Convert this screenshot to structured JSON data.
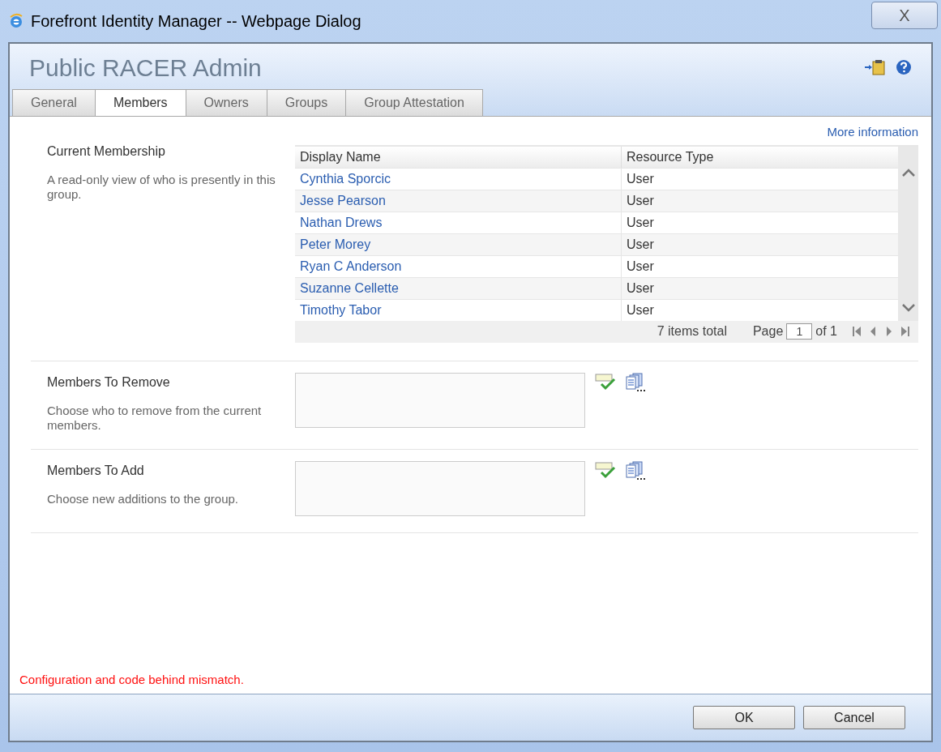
{
  "window": {
    "title": "Forefront Identity Manager -- Webpage Dialog",
    "close": "X"
  },
  "header": {
    "title": "Public RACER Admin"
  },
  "tabs": [
    {
      "label": "General",
      "selected": false
    },
    {
      "label": "Members",
      "selected": true
    },
    {
      "label": "Owners",
      "selected": false
    },
    {
      "label": "Groups",
      "selected": false
    },
    {
      "label": "Group Attestation",
      "selected": false
    }
  ],
  "more_info": "More information",
  "sections": [
    {
      "kind": "table",
      "label": "Current Membership",
      "description": "A read-only view of who is presently in this group.",
      "table": {
        "columns": [
          "Display Name",
          "Resource Type"
        ],
        "rows": [
          [
            "Cynthia Sporcic",
            "User"
          ],
          [
            "Jesse Pearson",
            "User"
          ],
          [
            "Nathan Drews",
            "User"
          ],
          [
            "Peter Morey",
            "User"
          ],
          [
            "Ryan C Anderson",
            "User"
          ],
          [
            "Suzanne Cellette",
            "User"
          ],
          [
            "Timothy Tabor",
            "User"
          ]
        ],
        "total": "7 items total",
        "page_label": "Page",
        "page": "1",
        "page_of": "of 1"
      }
    },
    {
      "kind": "picker",
      "label": "Members To Remove",
      "description": "Choose who to remove from the current members."
    },
    {
      "kind": "picker",
      "label": "Members To Add",
      "description": "Choose new additions to the group."
    }
  ],
  "error": "Configuration and code behind mismatch.",
  "buttons": [
    "OK",
    "Cancel"
  ]
}
